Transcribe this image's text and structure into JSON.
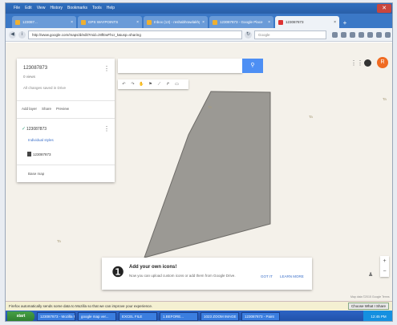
{
  "browser": {
    "menu": [
      "File",
      "Edit",
      "View",
      "History",
      "Bookmarks",
      "Tools",
      "Help"
    ],
    "tabs": [
      {
        "label": "123087..."
      },
      {
        "label": "GPS WAYPOINTS"
      },
      {
        "label": "Inbox (13) - reshabhrawlakhy..."
      },
      {
        "label": "123087873 - Google Place"
      },
      {
        "label": "123087873",
        "active": true
      }
    ],
    "url": "http://www.google.com/maps/d/edit?mid=z8fEwFhcr_k&usp=sharing",
    "search_placeholder": "Google"
  },
  "panel": {
    "title": "123087873",
    "views": "0 views",
    "saved": "All changes saved in Drive",
    "actions": [
      "Add layer",
      "Share",
      "Preview"
    ],
    "layer_name": "123087873",
    "layer_style": "Individual styles",
    "layer_item": "123087873",
    "base_map": "Base map"
  },
  "map": {
    "search_value": "",
    "labels": [
      {
        "text": "Ta"
      },
      {
        "text": "Ta"
      },
      {
        "text": "Ta"
      },
      {
        "text": "Ta"
      }
    ],
    "polygon_color": "#9b9994",
    "footer": "Map data ©2015 Google  Terms"
  },
  "card": {
    "title": "Add your own icons!",
    "description": "Now you can upload custom icons or add them from Google Drive.",
    "got_it": "GOT IT",
    "learn_more": "LEARN MORE"
  },
  "user": {
    "initial": "R"
  },
  "notification": {
    "message": "Firefox automatically sends some data to Mozilla so that we can improve your experience.",
    "button": "Choose What I Share"
  },
  "taskbar": {
    "start": "start",
    "items": [
      "123087873 - Mozilla F...",
      "google map ver...",
      "EXCEL FILE",
      "1.BEFORE...",
      "1023 ZOOM IMAGE",
      "123087873 - Paint"
    ],
    "clock": "12:45 PM"
  }
}
